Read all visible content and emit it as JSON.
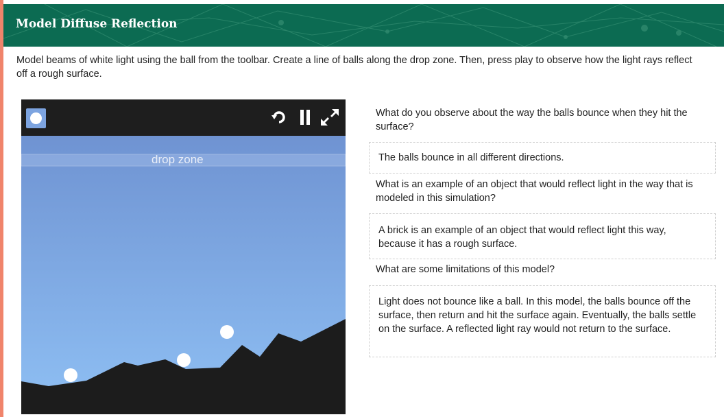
{
  "header": {
    "title": "Model Diffuse Reflection"
  },
  "instructions": "Model beams of white light using the ball from the toolbar. Create a line of balls along the drop zone. Then, press play to observe how the light rays reflect off a rough surface.",
  "simulation": {
    "drop_zone_label": "drop zone",
    "toolbar": {
      "ball_tool": "ball-icon",
      "reset": "reset-icon",
      "pause": "pause-icon",
      "fullscreen": "fullscreen-icon"
    },
    "colors": {
      "sky_top": "#6f93d2",
      "sky_bottom": "#8fc0f4",
      "ground": "#1c1c1c",
      "header": "#0c6b52"
    }
  },
  "qa": [
    {
      "question": "What do you observe about the way the balls bounce when they hit the surface?",
      "answer": "The balls bounce in all different directions."
    },
    {
      "question": "What is an example of an object that would reflect light in the way that is modeled in this simulation?",
      "answer": "A brick is an example of an object that would reflect light this way, because it has a rough surface."
    },
    {
      "question": "What are some limitations of this model?",
      "answer": "Light does not bounce like a ball. In this model, the balls bounce off the surface, then return and hit the surface again. Eventually, the balls settle on the surface. A reflected light ray would not return to the surface."
    }
  ]
}
